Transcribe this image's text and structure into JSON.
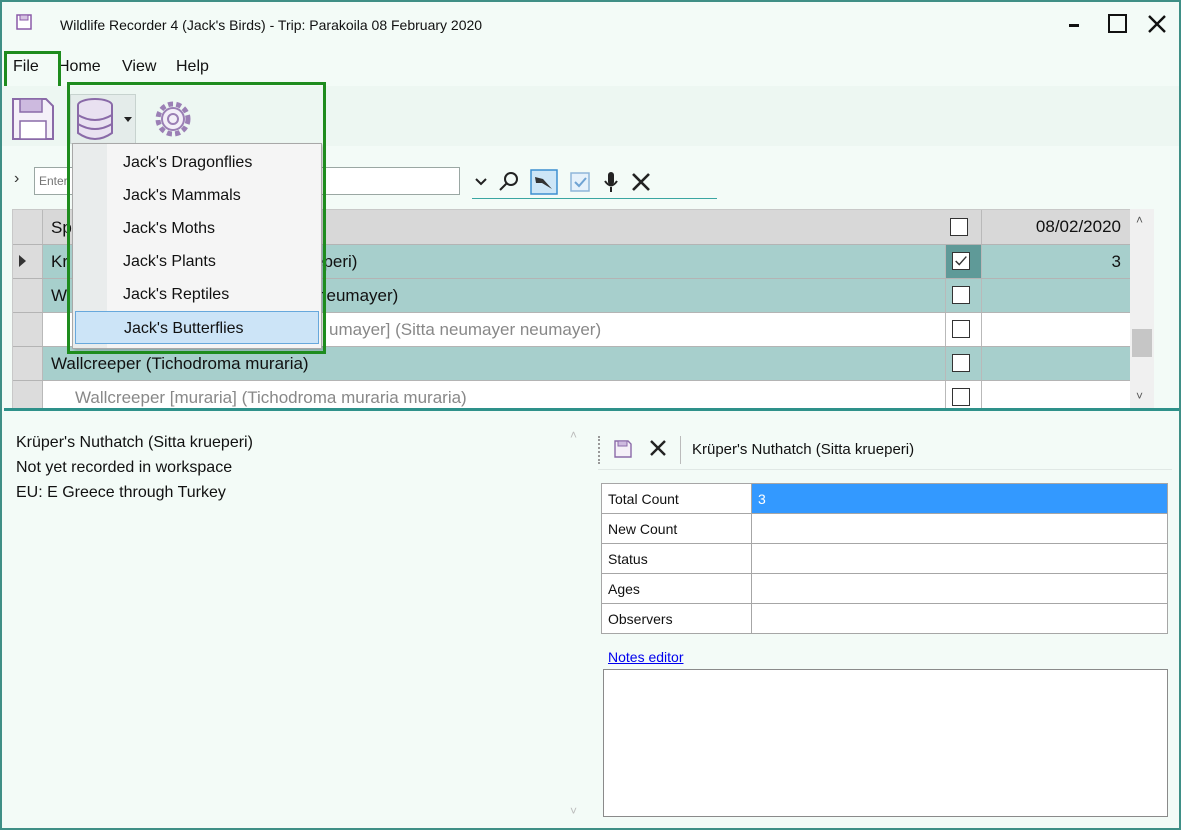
{
  "window": {
    "title": "Wildlife Recorder 4 (Jack's Birds) - Trip: Parakoila 08 February 2020"
  },
  "menu": [
    "File",
    "Home",
    "View",
    "Help"
  ],
  "database_menu": {
    "items": [
      "Jack's Dragonflies",
      "Jack's Mammals",
      "Jack's Moths",
      "Jack's Plants",
      "Jack's Reptiles",
      "Jack's Butterflies"
    ],
    "hovered": "Jack's Butterflies"
  },
  "search": {
    "placeholder": "Enter"
  },
  "grid": {
    "header_species": "Sp",
    "header_date": "08/02/2020",
    "rows": [
      {
        "name": "Kr",
        "name_tail": "eperi)",
        "checked": true,
        "value": "3",
        "current": true
      },
      {
        "name": "W",
        "name_tail": "neumayer)",
        "checked": false,
        "value": ""
      },
      {
        "name": "",
        "name_tail": "umayer] (Sitta neumayer neumayer)",
        "checked": false,
        "value": "",
        "sub": true
      },
      {
        "name": "Wallcreeper (Tichodroma muraria)",
        "checked": false,
        "value": ""
      },
      {
        "name": "Wallcreeper [muraria] (Tichodroma muraria muraria)",
        "checked": false,
        "value": "",
        "sub": true
      }
    ]
  },
  "info": {
    "lines": [
      "Krüper's Nuthatch (Sitta krueperi)",
      "Not yet recorded in workspace",
      "EU: E Greece through Turkey"
    ]
  },
  "detail": {
    "title": "Krüper's Nuthatch (Sitta krueperi)",
    "properties": [
      {
        "key": "Total Count",
        "value": "3"
      },
      {
        "key": "New Count",
        "value": ""
      },
      {
        "key": "Status",
        "value": ""
      },
      {
        "key": "Ages",
        "value": ""
      },
      {
        "key": "Observers",
        "value": ""
      }
    ],
    "notes_link": "Notes editor"
  },
  "colors": {
    "highlight_frame": "#1e8c1e",
    "selected_row": "#a7cfcc",
    "accent": "#2e918a",
    "selection_blue": "#3399ff"
  }
}
